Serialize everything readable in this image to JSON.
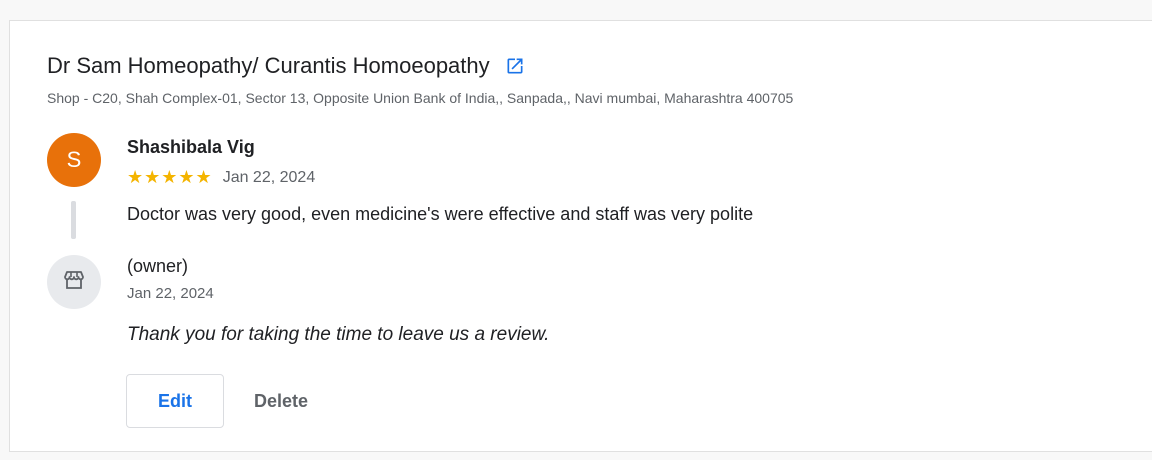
{
  "business": {
    "name": "Dr Sam Homeopathy/ Curantis Homoeopathy",
    "address": "Shop - C20, Shah Complex-01, Sector 13, Opposite Union Bank of India,, Sanpada,, Navi mumbai, Maharashtra 400705",
    "link_icon": "open-in-new-icon",
    "accent_color": "#1a73e8"
  },
  "review": {
    "avatar_initial": "S",
    "avatar_color": "#e8710a",
    "reviewer_name": "Shashibala Vig",
    "rating": 5,
    "stars": "★★★★★",
    "date": "Jan 22, 2024",
    "text": "Doctor was very good, even medicine's were effective and staff was very polite"
  },
  "owner_response": {
    "icon": "storefront-icon",
    "label": "(owner)",
    "date": "Jan 22, 2024",
    "text": "Thank you for taking the time to leave us a review."
  },
  "actions": {
    "edit_label": "Edit",
    "delete_label": "Delete"
  }
}
